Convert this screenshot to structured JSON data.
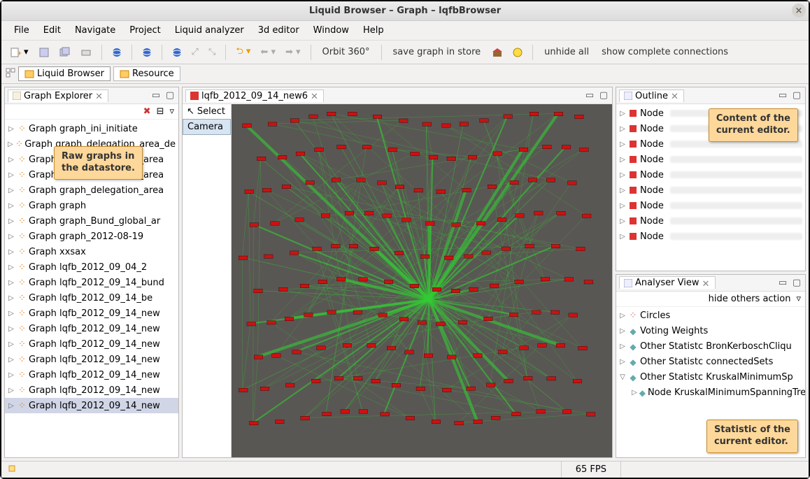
{
  "window_title": "Liquid Browser – Graph – lqfbBrowser",
  "menubar": [
    "File",
    "Edit",
    "Navigate",
    "Project",
    "Liquid analyzer",
    "3d editor",
    "Window",
    "Help"
  ],
  "toolbar_text": {
    "orbit": "Orbit 360°",
    "save": "save graph in store",
    "unhide": "unhide all",
    "show_conn": "show complete connections"
  },
  "perspectives": [
    {
      "label": "Liquid Browser",
      "active": true
    },
    {
      "label": "Resource",
      "active": false
    }
  ],
  "graph_explorer": {
    "title": "Graph Explorer",
    "items": [
      "Graph graph_ini_initiate",
      "Graph graph_delegation_area_de",
      "Graph graph_delegation_area",
      "Graph graph_delegation_area",
      "Graph graph_delegation_area",
      "Graph graph",
      "Graph graph_Bund_global_ar",
      "Graph graph_2012-08-19",
      "Graph xxsax",
      "Graph lqfb_2012_09_04_2",
      "Graph lqfb_2012_09_14_bund",
      "Graph lqfb_2012_09_14_be",
      "Graph lqfb_2012_09_14_new",
      "Graph lqfb_2012_09_14_new",
      "Graph lqfb_2012_09_14_new",
      "Graph lqfb_2012_09_14_new",
      "Graph lqfb_2012_09_14_new",
      "Graph lqfb_2012_09_14_new",
      "Graph lqfb_2012_09_14_new"
    ],
    "selected_index": 18
  },
  "editor": {
    "tab_title": "lqfb_2012_09_14_new6",
    "tools": [
      "Select",
      "Camera"
    ],
    "selected_tool": "Camera"
  },
  "outline": {
    "title": "Outline",
    "items": [
      "Node",
      "Node",
      "Node",
      "Node",
      "Node",
      "Node",
      "Node",
      "Node",
      "Node"
    ]
  },
  "analyser": {
    "title": "Analyser View",
    "action_label": "hide others action",
    "items": [
      {
        "icon": "circles",
        "label": "Circles",
        "caret": true,
        "indent": 0
      },
      {
        "icon": "diamond",
        "label": "Voting Weights",
        "caret": true,
        "indent": 0
      },
      {
        "icon": "diamond",
        "label": "Other Statistc BronKerboschCliqu",
        "caret": true,
        "indent": 0
      },
      {
        "icon": "diamond",
        "label": "Other Statistc connectedSets",
        "caret": true,
        "indent": 0
      },
      {
        "icon": "diamond",
        "label": "Other Statistc KruskalMinimumSp",
        "caret": true,
        "indent": 0,
        "open": true
      },
      {
        "icon": "diamond",
        "label": "Node KruskalMinimumSpanningTree",
        "caret": true,
        "indent": 1
      }
    ]
  },
  "status": {
    "fps": "65 FPS"
  },
  "callouts": {
    "graphs": "Raw graphs in\nthe datastore.",
    "outline": "Content of the\ncurrent editor.",
    "analyser": "Statistic of the\ncurrent editor."
  }
}
